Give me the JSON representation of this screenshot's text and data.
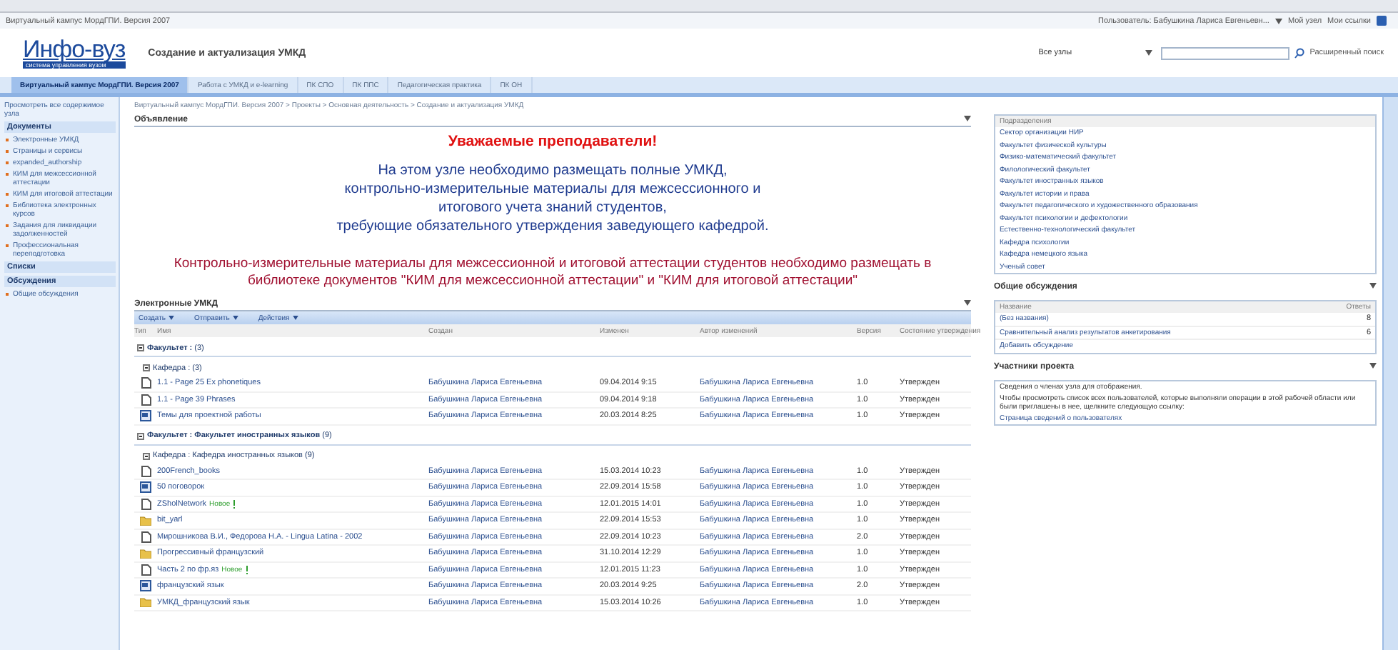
{
  "top_bar": {
    "site_path": "Виртуальный кампус МордГПИ. Версия 2007",
    "user": "Пользователь: Бабушкина Лариса Евгеньевн...",
    "links": [
      "Мой узел",
      "Мои ссылки"
    ]
  },
  "header": {
    "logo": "Инфо-вуз",
    "logo_subtitle": "система управления вузом",
    "title": "Создание и актуализация УМКД",
    "search_scope": "Все узлы",
    "advanced_search": "Расширенный поиск"
  },
  "tabs": [
    {
      "label": "Виртуальный кампус МордГПИ. Версия 2007",
      "selected": true
    },
    {
      "label": "Работа с УМКД и e-learning",
      "selected": false
    },
    {
      "label": "ПК СПО",
      "selected": false
    },
    {
      "label": "ПК ППС",
      "selected": false
    },
    {
      "label": "Педагогическая практика",
      "selected": false
    },
    {
      "label": "ПК ОН",
      "selected": false
    }
  ],
  "sidebar": {
    "view_all": "Просмотреть все содержимое узла",
    "sections": [
      {
        "title": "Документы",
        "items": [
          "Электронные УМКД",
          "Страницы и сервисы",
          "expanded_authorship",
          "КИМ для межсессионной аттестации",
          "КИМ для итоговой аттестации",
          "Библиотека электронных курсов",
          "Задания для ликвидации задолженностей",
          "Профессиональная переподготовка"
        ]
      },
      {
        "title": "Списки"
      },
      {
        "title": "Обсуждения",
        "items": [
          "Общие обсуждения"
        ]
      }
    ]
  },
  "breadcrumb": "Виртуальный кампус МордГПИ. Версия 2007 > Проекты > Основная деятельность > Создание и актуализация УМКД",
  "announcement": {
    "title": "Объявление",
    "heading": "Уважаемые преподаватели!",
    "body": "На этом узле необходимо размещать полные УМКД,\nконтрольно-измерительные материалы для межсессионного и\nитогового учета знаний студентов,\nтребующие обязательного утверждения заведующего кафедрой.",
    "note": "Контрольно-измерительные материалы для межсессионной и итоговой аттестации студентов необходимо размещать в\nбиблиотеке документов \"КИМ для межсессионной аттестации\" и \"КИМ для итоговой аттестации\""
  },
  "library": {
    "title": "Электронные УМКД",
    "toolbar": [
      "Создать",
      "Отправить",
      "Действия"
    ],
    "columns": [
      "Тип",
      "Имя",
      "Создан",
      "Изменен",
      "Автор изменений",
      "Версия",
      "Состояние утверждения"
    ],
    "groups": [
      {
        "label": "Факультет :",
        "count": "(3)",
        "subgroups": [
          {
            "label": "Кафедра :",
            "count": "(3)",
            "rows": [
              {
                "kind": "file",
                "name": "1.1 - Page 25 Ex phonetiques",
                "new": false,
                "created_by": "Бабушкина Лариса Евгеньевна",
                "modified": "09.04.2014 9:15",
                "modified_by": "Бабушкина Лариса Евгеньевна",
                "version": "1.0",
                "status": "Утвержден"
              },
              {
                "kind": "file",
                "name": "1.1 - Page 39 Phrases",
                "new": false,
                "created_by": "Бабушкина Лариса Евгеньевна",
                "modified": "09.04.2014 9:18",
                "modified_by": "Бабушкина Лариса Евгеньевна",
                "version": "1.0",
                "status": "Утвержден"
              },
              {
                "kind": "word",
                "name": "Темы для проектной работы",
                "new": false,
                "created_by": "Бабушкина Лариса Евгеньевна",
                "modified": "20.03.2014 8:25",
                "modified_by": "Бабушкина Лариса Евгеньевна",
                "version": "1.0",
                "status": "Утвержден"
              }
            ]
          }
        ]
      },
      {
        "label": "Факультет :",
        "value": "Факультет иностранных языков",
        "count": "(9)",
        "subgroups": [
          {
            "label": "Кафедра :",
            "value": "Кафедра иностранных языков",
            "count": "(9)",
            "rows": [
              {
                "kind": "file",
                "name": "200French_books",
                "new": false,
                "created_by": "Бабушкина Лариса Евгеньевна",
                "modified": "15.03.2014 10:23",
                "modified_by": "Бабушкина Лариса Евгеньевна",
                "version": "1.0",
                "status": "Утвержден"
              },
              {
                "kind": "word",
                "name": "50 поговорок",
                "new": false,
                "created_by": "Бабушкина Лариса Евгеньевна",
                "modified": "22.09.2014 15:58",
                "modified_by": "Бабушкина Лариса Евгеньевна",
                "version": "1.0",
                "status": "Утвержден"
              },
              {
                "kind": "file",
                "name": "ZSholNetwork",
                "new": true,
                "new_label": "Новое",
                "created_by": "Бабушкина Лариса Евгеньевна",
                "modified": "12.01.2015 14:01",
                "modified_by": "Бабушкина Лариса Евгеньевна",
                "version": "1.0",
                "status": "Утвержден"
              },
              {
                "kind": "folder",
                "name": "bit_yarl",
                "new": false,
                "created_by": "Бабушкина Лариса Евгеньевна",
                "modified": "22.09.2014 15:53",
                "modified_by": "Бабушкина Лариса Евгеньевна",
                "version": "1.0",
                "status": "Утвержден"
              },
              {
                "kind": "file",
                "name": "Мирошникова В.И., Федорова Н.А. - Lingua Latina - 2002",
                "new": false,
                "created_by": "Бабушкина Лариса Евгеньевна",
                "modified": "22.09.2014 10:23",
                "modified_by": "Бабушкина Лариса Евгеньевна",
                "version": "2.0",
                "status": "Утвержден"
              },
              {
                "kind": "folder",
                "name": "Прогрессивный французский",
                "new": false,
                "created_by": "Бабушкина Лариса Евгеньевна",
                "modified": "31.10.2014 12:29",
                "modified_by": "Бабушкина Лариса Евгеньевна",
                "version": "1.0",
                "status": "Утвержден"
              },
              {
                "kind": "file",
                "name": "Часть 2 по фр.яз",
                "new": true,
                "new_label": "Новое",
                "created_by": "Бабушкина Лариса Евгеньевна",
                "modified": "12.01.2015 11:23",
                "modified_by": "Бабушкина Лариса Евгеньевна",
                "version": "1.0",
                "status": "Утвержден"
              },
              {
                "kind": "word",
                "name": "французский язык",
                "new": false,
                "created_by": "Бабушкина Лариса Евгеньевна",
                "modified": "20.03.2014 9:25",
                "modified_by": "Бабушкина Лариса Евгеньевна",
                "version": "2.0",
                "status": "Утвержден"
              },
              {
                "kind": "folder",
                "name": "УМКД_французский язык",
                "new": false,
                "created_by": "Бабушкина Лариса Евгеньевна",
                "modified": "15.03.2014 10:26",
                "modified_by": "Бабушкина Лариса Евгеньевна",
                "version": "1.0",
                "status": "Утвержден"
              }
            ]
          }
        ]
      }
    ]
  },
  "departments": {
    "title": "Подразделения",
    "items": [
      "Сектор организации НИР",
      "Факультет физической культуры",
      "Физико-математический факультет",
      "Филологический факультет",
      "Факультет иностранных языков",
      "Факультет истории и права",
      "Факультет педагогического и художественного образования",
      "Факультет психологии и дефектологии",
      "Естественно-технологический факультет",
      "Кафедра психологии",
      "Кафедра немецкого языка",
      "Ученый совет"
    ]
  },
  "discussions": {
    "title": "Общие обсуждения",
    "columns": [
      "Название",
      "Ответы"
    ],
    "rows": [
      {
        "title": "(Без названия)",
        "replies": "8"
      },
      {
        "title": "Сравнительный анализ результатов анкетирования",
        "replies": "6"
      }
    ],
    "add": "Добавить обсуждение"
  },
  "members": {
    "title": "Участники проекта",
    "empty": "Сведения о членах узла для отображения.",
    "hint": "Чтобы просмотреть список всех пользователей, которые выполняли операции в этой рабочей области или были приглашены в нее, щелкните следующую ссылку:",
    "link": "Страница сведений о пользователях"
  }
}
